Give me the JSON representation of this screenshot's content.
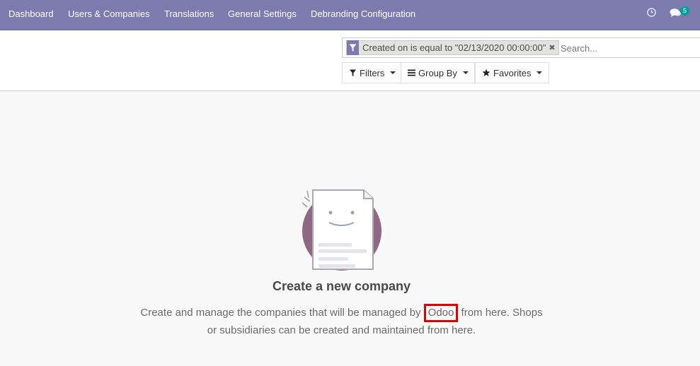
{
  "topbar": {
    "menu": [
      {
        "label": "Dashboard"
      },
      {
        "label": "Users & Companies"
      },
      {
        "label": "Translations"
      },
      {
        "label": "General Settings"
      },
      {
        "label": "Debranding Configuration"
      }
    ],
    "activity_icon": "clock-icon",
    "messaging_icon": "chat-icon",
    "messaging_count": "5"
  },
  "search": {
    "facet_icon": "filter-icon",
    "facet_label": "Created on is equal to \"02/13/2020 00:00:00\"",
    "placeholder": "Search..."
  },
  "toolbar": {
    "filters_label": "Filters",
    "group_by_label": "Group By",
    "favorites_label": "Favorites"
  },
  "empty_state": {
    "title": "Create a new company",
    "text_before": "Create and manage the companies that will be managed by",
    "highlighted": "Odoo",
    "text_after": "from here. Shops or subsidiaries can be created and maintained from here."
  },
  "colors": {
    "topbar": "#7c7bad",
    "illustration_circle": "#875a7b",
    "badge": "#00a09d",
    "highlight_box": "#e00000"
  }
}
